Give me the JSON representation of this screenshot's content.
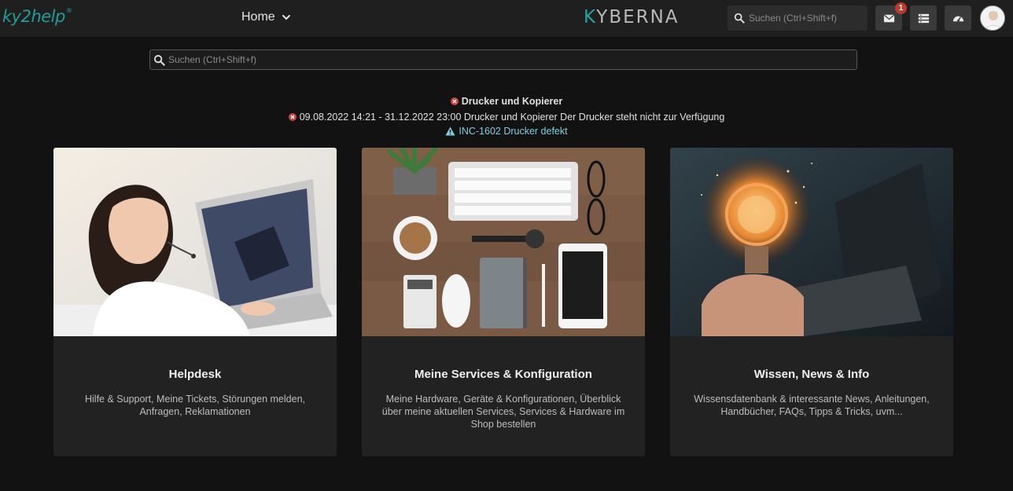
{
  "header": {
    "logo_text": "ky2help",
    "logo_mark": "®",
    "home_label": "Home",
    "brand_prefix": "K",
    "brand_rest": "YBERNA",
    "search_placeholder": "Suchen (Ctrl+Shift+f)",
    "mail_badge": "1",
    "icons": [
      "search-icon",
      "mail-icon",
      "list-icon",
      "dashboard-icon",
      "chevron-down-icon"
    ]
  },
  "main_search": {
    "placeholder": "Suchen (Ctrl+Shift+f)"
  },
  "alerts": {
    "title": "Drucker und Kopierer",
    "message": "09.08.2022 14:21 - 31.12.2022 23:00 Drucker und Kopierer Der Drucker steht nicht zur Verfügung",
    "incident": "INC-1602 Drucker defekt",
    "colors": {
      "error": "#d04040",
      "incident_link": "#7ecfe0"
    }
  },
  "cards": [
    {
      "title": "Helpdesk",
      "desc": "Hilfe & Support, Meine Tickets, Störungen melden, Anfragen, Reklamationen"
    },
    {
      "title": "Meine Services & Konfiguration",
      "desc": "Meine Hardware, Geräte & Konfigurationen, Überblick über meine aktuellen Services, Services & Hardware im Shop bestellen"
    },
    {
      "title": "Wissen, News & Info",
      "desc": "Wissensdatenbank & interessante News, Anleitungen, Handbücher, FAQs, Tipps & Tricks, uvm..."
    }
  ],
  "colors": {
    "accent": "#1f9e99",
    "background": "#121212",
    "topbar": "#1f1f1f",
    "card": "#222222"
  }
}
